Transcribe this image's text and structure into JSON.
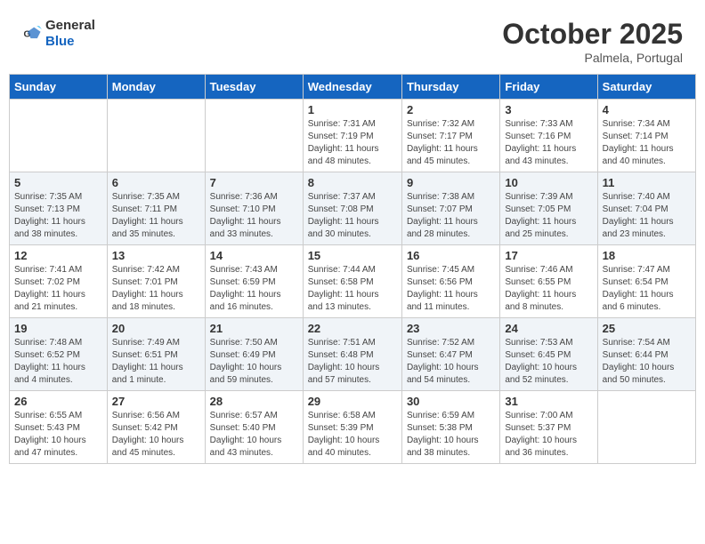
{
  "header": {
    "logo_general": "General",
    "logo_blue": "Blue",
    "month": "October 2025",
    "location": "Palmela, Portugal"
  },
  "weekdays": [
    "Sunday",
    "Monday",
    "Tuesday",
    "Wednesday",
    "Thursday",
    "Friday",
    "Saturday"
  ],
  "weeks": [
    [
      {
        "day": "",
        "info": ""
      },
      {
        "day": "",
        "info": ""
      },
      {
        "day": "",
        "info": ""
      },
      {
        "day": "1",
        "info": "Sunrise: 7:31 AM\nSunset: 7:19 PM\nDaylight: 11 hours\nand 48 minutes."
      },
      {
        "day": "2",
        "info": "Sunrise: 7:32 AM\nSunset: 7:17 PM\nDaylight: 11 hours\nand 45 minutes."
      },
      {
        "day": "3",
        "info": "Sunrise: 7:33 AM\nSunset: 7:16 PM\nDaylight: 11 hours\nand 43 minutes."
      },
      {
        "day": "4",
        "info": "Sunrise: 7:34 AM\nSunset: 7:14 PM\nDaylight: 11 hours\nand 40 minutes."
      }
    ],
    [
      {
        "day": "5",
        "info": "Sunrise: 7:35 AM\nSunset: 7:13 PM\nDaylight: 11 hours\nand 38 minutes."
      },
      {
        "day": "6",
        "info": "Sunrise: 7:35 AM\nSunset: 7:11 PM\nDaylight: 11 hours\nand 35 minutes."
      },
      {
        "day": "7",
        "info": "Sunrise: 7:36 AM\nSunset: 7:10 PM\nDaylight: 11 hours\nand 33 minutes."
      },
      {
        "day": "8",
        "info": "Sunrise: 7:37 AM\nSunset: 7:08 PM\nDaylight: 11 hours\nand 30 minutes."
      },
      {
        "day": "9",
        "info": "Sunrise: 7:38 AM\nSunset: 7:07 PM\nDaylight: 11 hours\nand 28 minutes."
      },
      {
        "day": "10",
        "info": "Sunrise: 7:39 AM\nSunset: 7:05 PM\nDaylight: 11 hours\nand 25 minutes."
      },
      {
        "day": "11",
        "info": "Sunrise: 7:40 AM\nSunset: 7:04 PM\nDaylight: 11 hours\nand 23 minutes."
      }
    ],
    [
      {
        "day": "12",
        "info": "Sunrise: 7:41 AM\nSunset: 7:02 PM\nDaylight: 11 hours\nand 21 minutes."
      },
      {
        "day": "13",
        "info": "Sunrise: 7:42 AM\nSunset: 7:01 PM\nDaylight: 11 hours\nand 18 minutes."
      },
      {
        "day": "14",
        "info": "Sunrise: 7:43 AM\nSunset: 6:59 PM\nDaylight: 11 hours\nand 16 minutes."
      },
      {
        "day": "15",
        "info": "Sunrise: 7:44 AM\nSunset: 6:58 PM\nDaylight: 11 hours\nand 13 minutes."
      },
      {
        "day": "16",
        "info": "Sunrise: 7:45 AM\nSunset: 6:56 PM\nDaylight: 11 hours\nand 11 minutes."
      },
      {
        "day": "17",
        "info": "Sunrise: 7:46 AM\nSunset: 6:55 PM\nDaylight: 11 hours\nand 8 minutes."
      },
      {
        "day": "18",
        "info": "Sunrise: 7:47 AM\nSunset: 6:54 PM\nDaylight: 11 hours\nand 6 minutes."
      }
    ],
    [
      {
        "day": "19",
        "info": "Sunrise: 7:48 AM\nSunset: 6:52 PM\nDaylight: 11 hours\nand 4 minutes."
      },
      {
        "day": "20",
        "info": "Sunrise: 7:49 AM\nSunset: 6:51 PM\nDaylight: 11 hours\nand 1 minute."
      },
      {
        "day": "21",
        "info": "Sunrise: 7:50 AM\nSunset: 6:49 PM\nDaylight: 10 hours\nand 59 minutes."
      },
      {
        "day": "22",
        "info": "Sunrise: 7:51 AM\nSunset: 6:48 PM\nDaylight: 10 hours\nand 57 minutes."
      },
      {
        "day": "23",
        "info": "Sunrise: 7:52 AM\nSunset: 6:47 PM\nDaylight: 10 hours\nand 54 minutes."
      },
      {
        "day": "24",
        "info": "Sunrise: 7:53 AM\nSunset: 6:45 PM\nDaylight: 10 hours\nand 52 minutes."
      },
      {
        "day": "25",
        "info": "Sunrise: 7:54 AM\nSunset: 6:44 PM\nDaylight: 10 hours\nand 50 minutes."
      }
    ],
    [
      {
        "day": "26",
        "info": "Sunrise: 6:55 AM\nSunset: 5:43 PM\nDaylight: 10 hours\nand 47 minutes."
      },
      {
        "day": "27",
        "info": "Sunrise: 6:56 AM\nSunset: 5:42 PM\nDaylight: 10 hours\nand 45 minutes."
      },
      {
        "day": "28",
        "info": "Sunrise: 6:57 AM\nSunset: 5:40 PM\nDaylight: 10 hours\nand 43 minutes."
      },
      {
        "day": "29",
        "info": "Sunrise: 6:58 AM\nSunset: 5:39 PM\nDaylight: 10 hours\nand 40 minutes."
      },
      {
        "day": "30",
        "info": "Sunrise: 6:59 AM\nSunset: 5:38 PM\nDaylight: 10 hours\nand 38 minutes."
      },
      {
        "day": "31",
        "info": "Sunrise: 7:00 AM\nSunset: 5:37 PM\nDaylight: 10 hours\nand 36 minutes."
      },
      {
        "day": "",
        "info": ""
      }
    ]
  ]
}
